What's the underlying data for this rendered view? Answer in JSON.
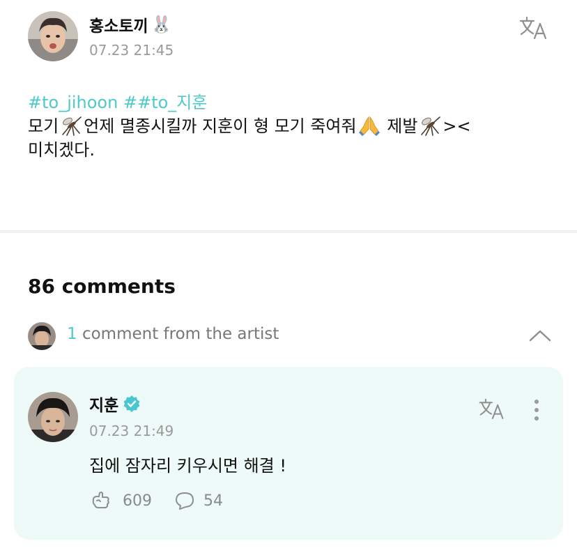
{
  "post": {
    "author": "홍소토끼",
    "author_emoji": "🐰",
    "timestamp": "07.23 21:45",
    "hashtags": [
      "#to_jihoon",
      "##to_지훈"
    ],
    "line1": {
      "t1": "모기",
      "t2": "언제 멸종시킬까 지훈이 형 모기 죽여줘",
      "t3": " 제발",
      "t4": "><"
    },
    "line2": "미치겠다.",
    "icons": [
      "mosquito-emoji",
      "mosquito-emoji",
      "folded-hands-emoji",
      "mosquito-emoji",
      "translate-icon"
    ]
  },
  "comments": {
    "header": "86 comments",
    "artist_toggle": {
      "count": "1",
      "label": " comment from the artist",
      "icon": "chevron-up-icon"
    }
  },
  "artist_comment": {
    "author": "지훈",
    "timestamp": "07.23 21:49",
    "text": "집에 잠자리 키우시면 해결 !",
    "likes": "609",
    "replies": "54",
    "icons": [
      "verified-badge-icon",
      "translate-icon",
      "more-vertical-icon",
      "like-icon",
      "comment-bubble-icon"
    ]
  },
  "colors": {
    "accent": "#4ec9c9",
    "card_background": "#eefaf8",
    "muted_text": "#9a9a9a",
    "verified": "#49c7d0"
  }
}
